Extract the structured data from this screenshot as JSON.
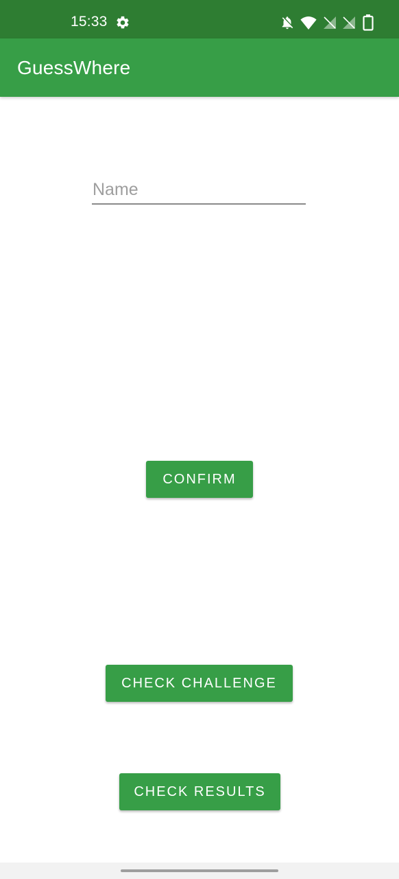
{
  "status_bar": {
    "time": "15:33",
    "icons": [
      "gear-icon",
      "bell-off-icon",
      "wifi-icon",
      "no-signal-icon",
      "no-signal-icon",
      "battery-icon"
    ],
    "background": "#2e7d32"
  },
  "app_bar": {
    "title": "GuessWhere",
    "background": "#379e47"
  },
  "form": {
    "name_placeholder": "Name",
    "name_value": ""
  },
  "buttons": {
    "confirm": "CONFIRM",
    "check_challenge": "CHECK CHALLENGE",
    "check_results": "CHECK RESULTS",
    "background": "#379e47"
  }
}
